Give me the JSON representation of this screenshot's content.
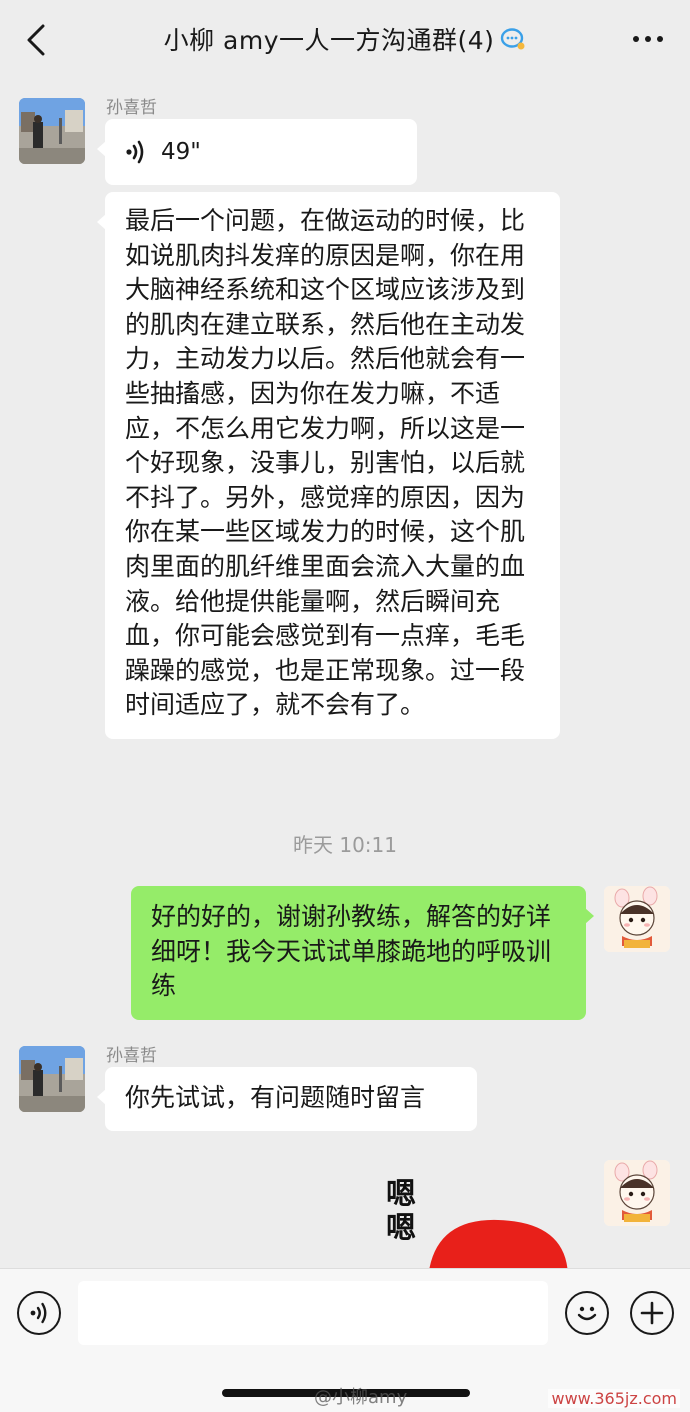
{
  "header": {
    "title": "小柳 amy一人一方沟通群(4)",
    "back_icon": "chevron-left-icon",
    "more_icon": "more-dots-icon",
    "badge_icon": "chat-bubble-icon"
  },
  "messages": {
    "m1": {
      "sender": "孙喜哲",
      "voice_duration": "49\""
    },
    "m2": {
      "text": "最后一个问题，在做运动的时候，比如说肌肉抖发痒的原因是啊，你在用大脑神经系统和这个区域应该涉及到的肌肉在建立联系，然后他在主动发力，主动发力以后。然后他就会有一些抽搐感，因为你在发力嘛，不适应，不怎么用它发力啊，所以这是一个好现象，没事儿，别害怕，以后就不抖了。另外，感觉痒的原因，因为你在某一些区域发力的时候，这个肌肉里面的肌纤维里面会流入大量的血液。给他提供能量啊，然后瞬间充血，你可能会感觉到有一点痒，毛毛躁躁的感觉，也是正常现象。过一段时间适应了，就不会有了。"
    },
    "timestamp": "昨天 10:11",
    "m3": {
      "text": "好的好的，谢谢孙教练，解答的好详细呀！我今天试试单膝跪地的呼吸训练"
    },
    "m4": {
      "sender": "孙喜哲",
      "text": "你先试试，有问题随时留言"
    },
    "m5": {
      "sticker_text": "嗯嗯"
    }
  },
  "input_bar": {
    "voice_icon": "voice-icon",
    "emoji_icon": "emoji-icon",
    "add_icon": "plus-icon",
    "placeholder": ""
  },
  "watermarks": {
    "weibo": "@小柳amy",
    "site": "www.365jz.com"
  },
  "colors": {
    "background": "#ededed",
    "own_bubble": "#95ec69",
    "other_bubble": "#ffffff",
    "sticker_red": "#e8201a"
  }
}
